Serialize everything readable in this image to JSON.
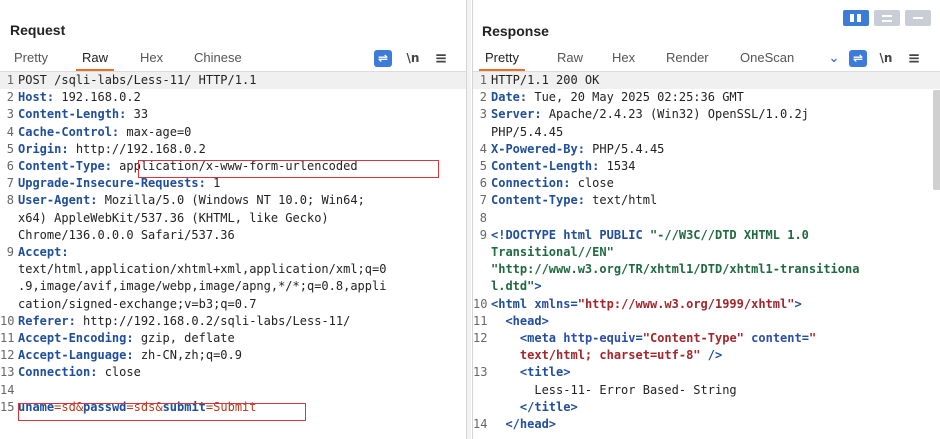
{
  "request": {
    "title": "Request",
    "tabs": [
      "Pretty",
      "Raw",
      "Hex",
      "Chinese"
    ],
    "active_tab": "Raw",
    "newline_label": "\\n",
    "menu_label": "≡",
    "lines": [
      {
        "n": "1",
        "k": "",
        "v": "POST /sqli-labs/Less-11/ HTTP/1.1"
      },
      {
        "n": "2",
        "k": "Host",
        "v": "192.168.0.2"
      },
      {
        "n": "3",
        "k": "Content-Length",
        "v": "33"
      },
      {
        "n": "4",
        "k": "Cache-Control",
        "v": "max-age=0"
      },
      {
        "n": "5",
        "k": "Origin",
        "v": "http://192.168.0.2"
      },
      {
        "n": "6",
        "k": "Content-Type",
        "v": "application/x-www-form-urlencoded"
      },
      {
        "n": "7",
        "k": "Upgrade-Insecure-Requests",
        "v": "1"
      },
      {
        "n": "8",
        "k": "User-Agent",
        "v": "Mozilla/5.0 (Windows NT 10.0; Win64;"
      },
      {
        "n": "",
        "k": "",
        "v": "x64) AppleWebKit/537.36 (KHTML, like Gecko)"
      },
      {
        "n": "",
        "k": "",
        "v": "Chrome/136.0.0.0 Safari/537.36"
      },
      {
        "n": "9",
        "k": "Accept",
        "v": ""
      },
      {
        "n": "",
        "k": "",
        "v": "text/html,application/xhtml+xml,application/xml;q=0"
      },
      {
        "n": "",
        "k": "",
        "v": ".9,image/avif,image/webp,image/apng,*/*;q=0.8,appli"
      },
      {
        "n": "",
        "k": "",
        "v": "cation/signed-exchange;v=b3;q=0.7"
      },
      {
        "n": "10",
        "k": "Referer",
        "v": "http://192.168.0.2/sqli-labs/Less-11/"
      },
      {
        "n": "11",
        "k": "Accept-Encoding",
        "v": "gzip, deflate"
      },
      {
        "n": "12",
        "k": "Accept-Language",
        "v": "zh-CN,zh;q=0.9"
      },
      {
        "n": "13",
        "k": "Connection",
        "v": "close"
      },
      {
        "n": "14",
        "k": "",
        "v": ""
      }
    ],
    "body_line": {
      "n": "15",
      "params": [
        {
          "name": "uname",
          "value": "sd"
        },
        {
          "name": "passwd",
          "value": "sds"
        },
        {
          "name": "submit",
          "value": "Submit"
        }
      ]
    }
  },
  "response": {
    "title": "Response",
    "tabs": [
      "Pretty",
      "Raw",
      "Hex",
      "Render",
      "OneScan"
    ],
    "active_tab": "Pretty",
    "newline_label": "\\n",
    "menu_label": "≡",
    "header_lines": [
      {
        "n": "1",
        "k": "",
        "v": "HTTP/1.1 200 OK"
      },
      {
        "n": "2",
        "k": "Date",
        "v": "Tue, 20 May 2025 02:25:36 GMT"
      },
      {
        "n": "3",
        "k": "Server",
        "v": "Apache/2.4.23 (Win32) OpenSSL/1.0.2j"
      },
      {
        "n": "",
        "k": "",
        "v": "PHP/5.4.45"
      },
      {
        "n": "4",
        "k": "X-Powered-By",
        "v": "PHP/5.4.45"
      },
      {
        "n": "5",
        "k": "Content-Length",
        "v": "1534"
      },
      {
        "n": "6",
        "k": "Connection",
        "v": "close"
      },
      {
        "n": "7",
        "k": "Content-Type",
        "v": "text/html"
      },
      {
        "n": "8",
        "k": "",
        "v": ""
      }
    ],
    "html_lines": {
      "doctype_1": "<!DOCTYPE html PUBLIC ",
      "doctype_1s": "\"-//W3C//DTD XHTML 1.0",
      "doctype_2": "Transitional//EN\"",
      "doctype_3": "\"http://www.w3.org/TR/xhtml1/DTD/xhtml1-transitiona",
      "doctype_4a": "l.dtd\"",
      "doctype_4b": ">",
      "html_open": "<html ",
      "html_attr": "xmlns",
      "html_eq": "=",
      "html_val": "\"http://www.w3.org/1999/xhtml\"",
      "html_close": ">",
      "head_open": "<head>",
      "meta_open": "<meta ",
      "meta_attr1": "http-equiv",
      "meta_val1": "\"Content-Type\"",
      "meta_attr2": "content",
      "meta_val2a": "\"",
      "meta_val2b": "text/html; charset=utf-8\"",
      "meta_close": " />",
      "title_open": "<title>",
      "title_text": "Less-11- Error Based- String",
      "title_close": "</title>",
      "head_close": "</head>",
      "nums": [
        "9",
        "",
        "",
        "",
        "10",
        "11",
        "12",
        "",
        "13",
        "",
        "",
        "14"
      ]
    }
  },
  "colors": {
    "accent": "#e8702a",
    "brand_blue": "#3d7bd8",
    "highlight_box": "#d9363e"
  }
}
